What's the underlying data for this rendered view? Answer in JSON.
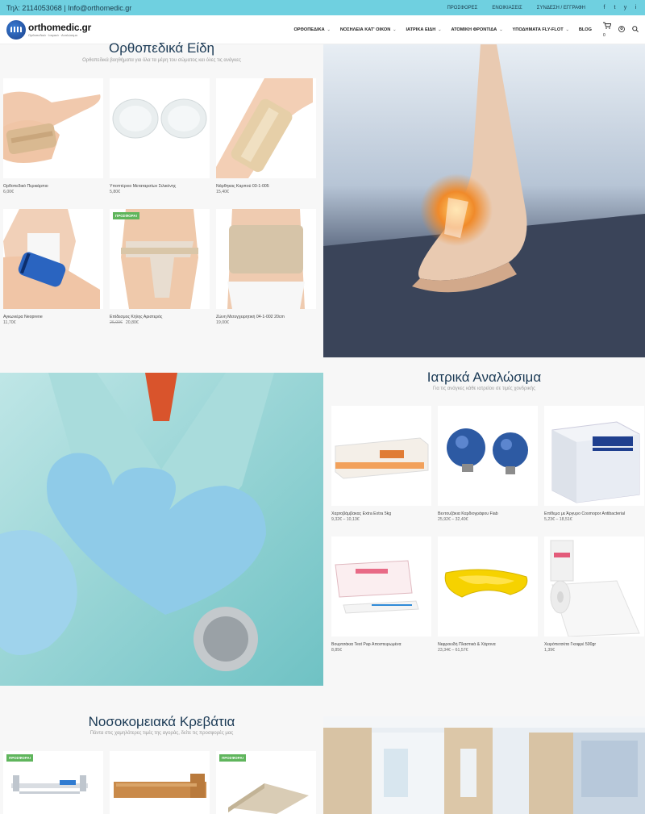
{
  "topbar": {
    "contact": "Τηλ: 2114053068 | Info@orthomedic.gr",
    "links": [
      "ΠΡΟΣΦΟΡΕΣ",
      "ΕΝΟΙΚΙΑΣΕΙΣ",
      "ΣΥΝΔΕΣΗ / ΕΓΓΡΑΦΗ"
    ],
    "social": [
      "f",
      "t",
      "y",
      "i"
    ]
  },
  "header": {
    "logo_name": "orthomedic.gr",
    "logo_tagline": "Ορθοπεδικά · Ιατρικά · Αναλώσιμα",
    "nav": [
      "ΟΡΘΟΠΕΔΙΚΑ",
      "ΝΟΣΗΛΕΙΑ ΚΑΤ' ΟΙΚΟΝ",
      "ΙΑΤΡΙΚΑ ΕΙΔΗ",
      "ΑΤΟΜΙΚΗ ΦΡΟΝΤΙΔΑ",
      "ΥΠΟΔΗΜΑΤΑ FLY-FLOT",
      "BLOG"
    ],
    "cart_count": "0"
  },
  "orthopedic": {
    "title": "Ορθοπεδικά Είδη",
    "subtitle": "Ορθοπεδικά βοηθήματα για όλα τα μέρη του σώματος και όλες τις ανάγκες",
    "products": [
      {
        "name": "Ορθοπεδικό Περικάρπιο",
        "price": "6,00€"
      },
      {
        "name": "Υποπτέρνιο Μεταταρσίων Σιλικόνης",
        "price": "5,80€"
      },
      {
        "name": "Νάρθηκας Καρπού 03-1-005",
        "price": "15,40€"
      },
      {
        "name": "Αγκωνιέρα Neoprene",
        "price": "11,70€"
      },
      {
        "name": "Επίδεσμος Κήλης Αριστερός",
        "price_old": "26,00€",
        "price": "20,80€",
        "badge": "ΠΡΟΣΦΟΡΑ!"
      },
      {
        "name": "Ζώνη Μετεγχειρητική 04-1-002 20cm",
        "price": "19,00€"
      }
    ]
  },
  "consumables": {
    "title": "Ιατρικά Αναλώσιμα",
    "subtitle": "Για τις ανάγκες κάθε ιατρείου σε τιμές χονδρικής",
    "products": [
      {
        "name": "Χαρτοβάμβακας Extra Extra 5kg",
        "price": "9,32€ – 10,13€"
      },
      {
        "name": "Βεντουζάκια Καρδιογράφου Fiab",
        "price": "25,92€ – 32,40€"
      },
      {
        "name": "Επίθεμα με Άργυρο Cosmopor Antibacterial",
        "price": "5,23€ – 18,51€"
      },
      {
        "name": "Βουρτσάκια Test Pap Αποστειρωμένα",
        "price": "8,85€"
      },
      {
        "name": "Νεφροειδή Πλαστικά & Χάρτινα",
        "price": "23,34€ – 61,57€"
      },
      {
        "name": "Χειρόπετσέτα Γκοφρέ 500gr",
        "price": "1,39€"
      }
    ]
  },
  "beds": {
    "title": "Νοσοκομειακά Κρεβάτια",
    "subtitle": "Πάντα στις χαμηλότερες τιμές της αγοράς, δείτε τις προσφορές μας",
    "products": [
      {
        "badge": "ΠΡΟΣΦΟΡΑ!"
      },
      {
        "badge": ""
      },
      {
        "badge": "ΠΡΟΣΦΟΡΑ!"
      }
    ]
  },
  "colors": {
    "topbar": "#6fd0e0",
    "title": "#1b3a55",
    "badge": "#5fb55c"
  }
}
